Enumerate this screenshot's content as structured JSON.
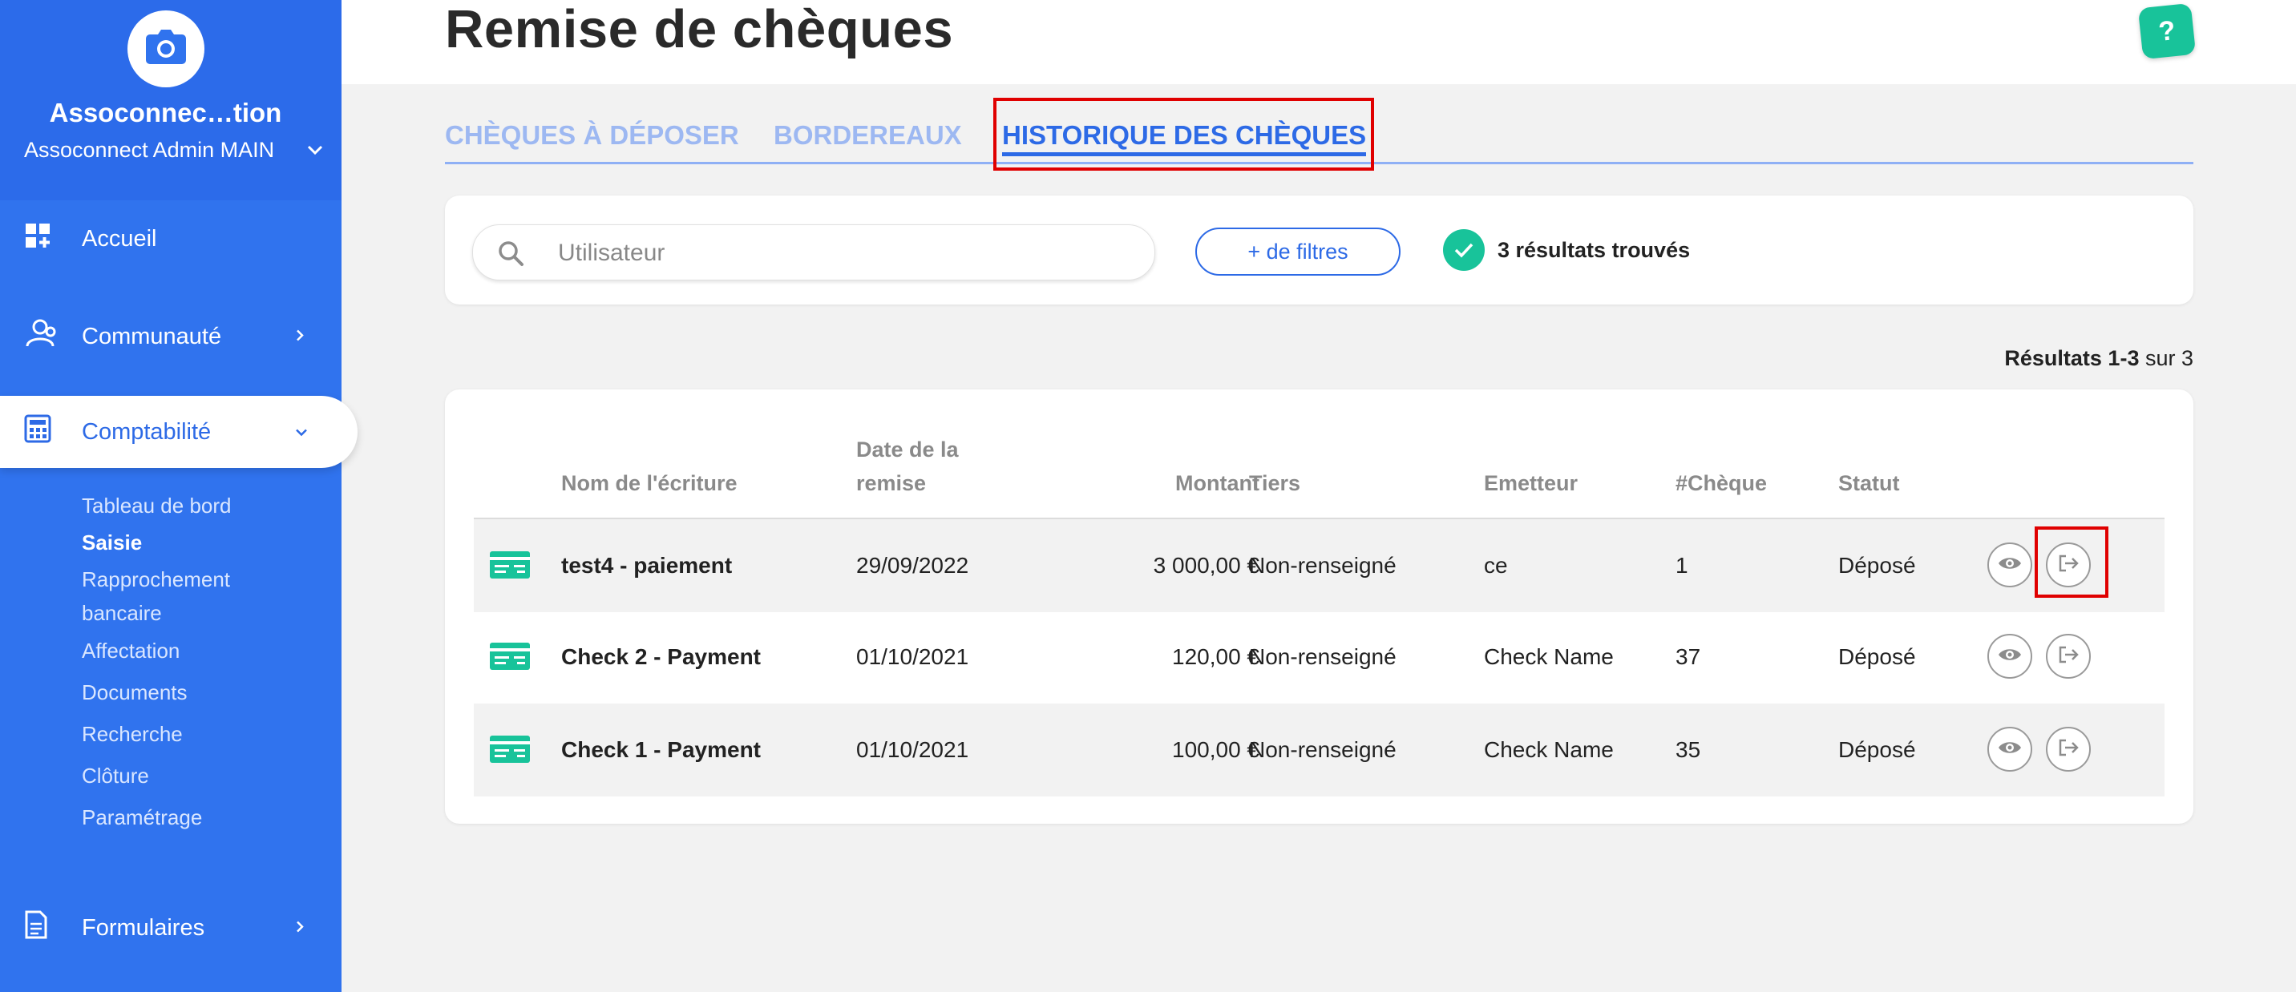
{
  "sidebar": {
    "org_name": "Assoconnec…tion",
    "account_name": "Assoconnect Admin MAIN",
    "nav": [
      {
        "label": "Accueil",
        "icon": "dashboard-icon"
      },
      {
        "label": "Communauté",
        "icon": "community-icon"
      },
      {
        "label": "Comptabilité",
        "icon": "calculator-icon"
      },
      {
        "label": "Formulaires",
        "icon": "form-icon"
      }
    ],
    "sub_items": [
      "Tableau de bord",
      "Saisie",
      "Rapprochement bancaire",
      "Affectation",
      "Documents",
      "Recherche",
      "Clôture",
      "Paramétrage"
    ]
  },
  "header": {
    "title": "Remise de chèques",
    "help_label": "?"
  },
  "tabs": [
    {
      "label": "CHÈQUES À DÉPOSER"
    },
    {
      "label": "BORDEREAUX"
    },
    {
      "label": "HISTORIQUE DES CHÈQUES"
    }
  ],
  "filters": {
    "search_placeholder": "Utilisateur",
    "more_filters_label": "+ de filtres",
    "results_found": "3 résultats trouvés"
  },
  "results_range": {
    "label": "Résultats 1-3",
    "suffix": " sur 3"
  },
  "table": {
    "headers": {
      "name": "Nom de l'écriture",
      "date_line1": "Date de la",
      "date_line2": "remise",
      "amount": "Montant",
      "tiers": "Tiers",
      "emitter": "Emetteur",
      "check_no": "#Chèque",
      "status": "Statut"
    },
    "rows": [
      {
        "name": "test4 - paiement",
        "date": "29/09/2022",
        "amount": "3 000,00 €",
        "tiers": "Non-renseigné",
        "emitter": "ce",
        "check_no": "1",
        "status": "Déposé"
      },
      {
        "name": "Check 2 - Payment",
        "date": "01/10/2021",
        "amount": "120,00 €",
        "tiers": "Non-renseigné",
        "emitter": "Check Name",
        "check_no": "37",
        "status": "Déposé"
      },
      {
        "name": "Check 1 - Payment",
        "date": "01/10/2021",
        "amount": "100,00 €",
        "tiers": "Non-renseigné",
        "emitter": "Check Name",
        "check_no": "35",
        "status": "Déposé"
      }
    ]
  },
  "colors": {
    "sidebar_blue": "#3073ee",
    "accent_blue": "#2d6ae6",
    "success_green": "#18c39a",
    "highlight_red": "#e00000"
  }
}
